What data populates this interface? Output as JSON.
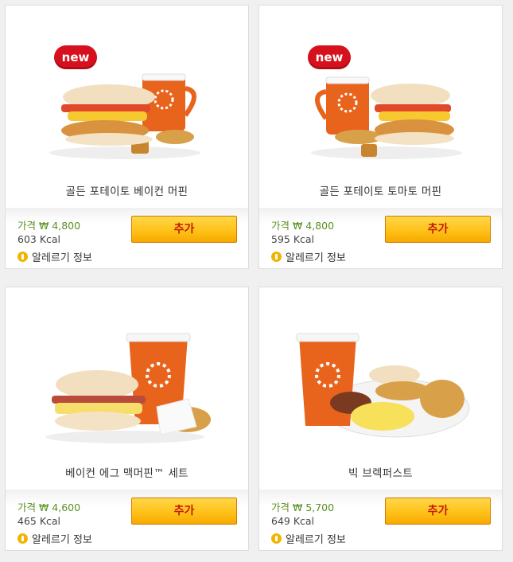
{
  "products": [
    {
      "badge": "new",
      "name": "골든 포테이토 베이컨 머핀",
      "price": "가격 ₩ 4,800",
      "kcal": "603 Kcal",
      "allergy": "알레르기 정보",
      "add": "추가"
    },
    {
      "badge": "new",
      "name": "골든 포테이토 토마토 머핀",
      "price": "가격 ₩ 4,800",
      "kcal": "595 Kcal",
      "allergy": "알레르기 정보",
      "add": "추가"
    },
    {
      "name": "베이컨 에그 맥머핀™ 세트",
      "price": "가격 ₩ 4,600",
      "kcal": "465 Kcal",
      "allergy": "알레르기 정보",
      "add": "추가"
    },
    {
      "name": "빅 브렉퍼스트",
      "price": "가격 ₩ 5,700",
      "kcal": "649 Kcal",
      "allergy": "알레르기 정보",
      "add": "추가"
    }
  ],
  "colors": {
    "button": "#ffc21a",
    "button_text": "#c41a00",
    "price": "#5a8f1f",
    "badge": "#d6111d"
  }
}
